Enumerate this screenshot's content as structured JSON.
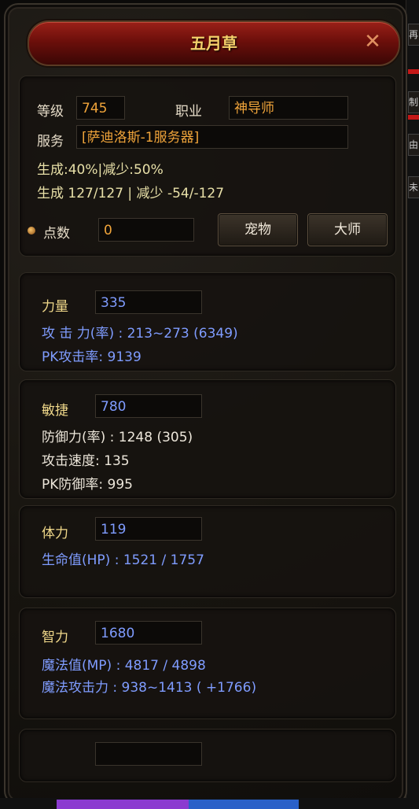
{
  "window": {
    "title": "五月草",
    "close_icon": "close-x-icon"
  },
  "info": {
    "level_label": "等级",
    "level_value": "745",
    "class_label": "职业",
    "class_value": "神导师",
    "server_label": "服务",
    "server_value": "[萨迪洛斯-1服务器]",
    "gen_line1": "生成:40%|减少:50%",
    "gen_line2": "生成 127/127 | 减少 -54/-127",
    "points_label": "点数",
    "points_value": "0",
    "pet_button": "宠物",
    "master_button": "大师"
  },
  "stats": {
    "strength": {
      "label": "力量",
      "value": "335",
      "line1": "攻 击 力(率) : 213~273 (6349)",
      "line2": "PK攻击率: 9139"
    },
    "agility": {
      "label": "敏捷",
      "value": "780",
      "line1": "防御力(率) : 1248 (305)",
      "line2": "攻击速度: 135",
      "line3": "PK防御率: 995"
    },
    "vitality": {
      "label": "体力",
      "value": "119",
      "line1": "生命值(HP) : 1521 / 1757"
    },
    "energy": {
      "label": "智力",
      "value": "1680",
      "line1": "魔法值(MP) : 4817 / 4898",
      "line2": "魔法攻击力 : 938~1413 ( +1766)"
    }
  },
  "colors": {
    "title": "#f4cf6a",
    "value_orange": "#f0a43a",
    "stat_blue": "#7f9cff",
    "text_white": "#ece6da"
  },
  "side_tabs": [
    "再",
    "制",
    "由",
    "未"
  ]
}
